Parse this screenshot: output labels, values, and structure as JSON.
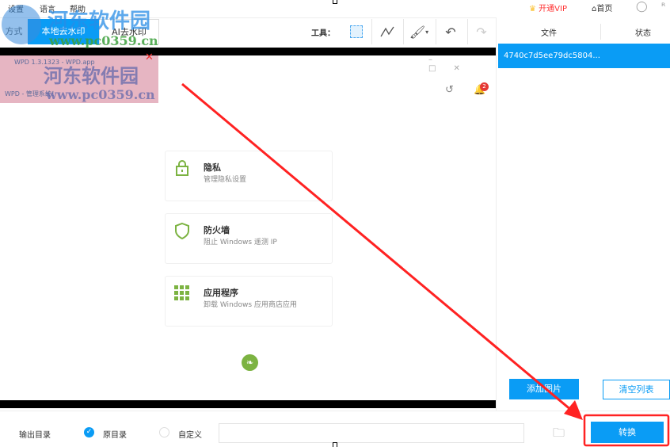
{
  "menu": [
    "设置",
    "语言",
    "帮助"
  ],
  "header": {
    "vip": "开通VIP",
    "home": "首页"
  },
  "tabs": {
    "mode_partial": "方式",
    "local": "本地去水印",
    "ai": "AI去水印"
  },
  "toolbar": {
    "tools_label": "工具："
  },
  "file_list": {
    "col_file": "文件",
    "col_status": "状态",
    "items": [
      "4740c7d5ee79dc5804..."
    ]
  },
  "preview": {
    "title": "WPD 1.3.1323 - WPD.app",
    "subtitle": "WPD - 管理系统！",
    "notif_count": "2",
    "cards": [
      {
        "title": "隐私",
        "desc": "管理隐私设置",
        "icon": "lock-icon"
      },
      {
        "title": "防火墙",
        "desc": "阻止 Windows 遥测 IP",
        "icon": "shield-icon"
      },
      {
        "title": "应用程序",
        "desc": "卸载 Windows 应用商店应用",
        "icon": "grid-icon"
      }
    ]
  },
  "watermark": {
    "text": "河东软件园",
    "url": "www.pc0359.cn"
  },
  "actions": {
    "add": "添加图片",
    "clear": "清空列表",
    "convert": "转换"
  },
  "output": {
    "label": "输出目录",
    "opt_original": "原目录",
    "opt_custom": "自定义",
    "path": ""
  },
  "colors": {
    "accent": "#0a9cf5",
    "annot": "#ff2222",
    "green": "#7cb342"
  }
}
